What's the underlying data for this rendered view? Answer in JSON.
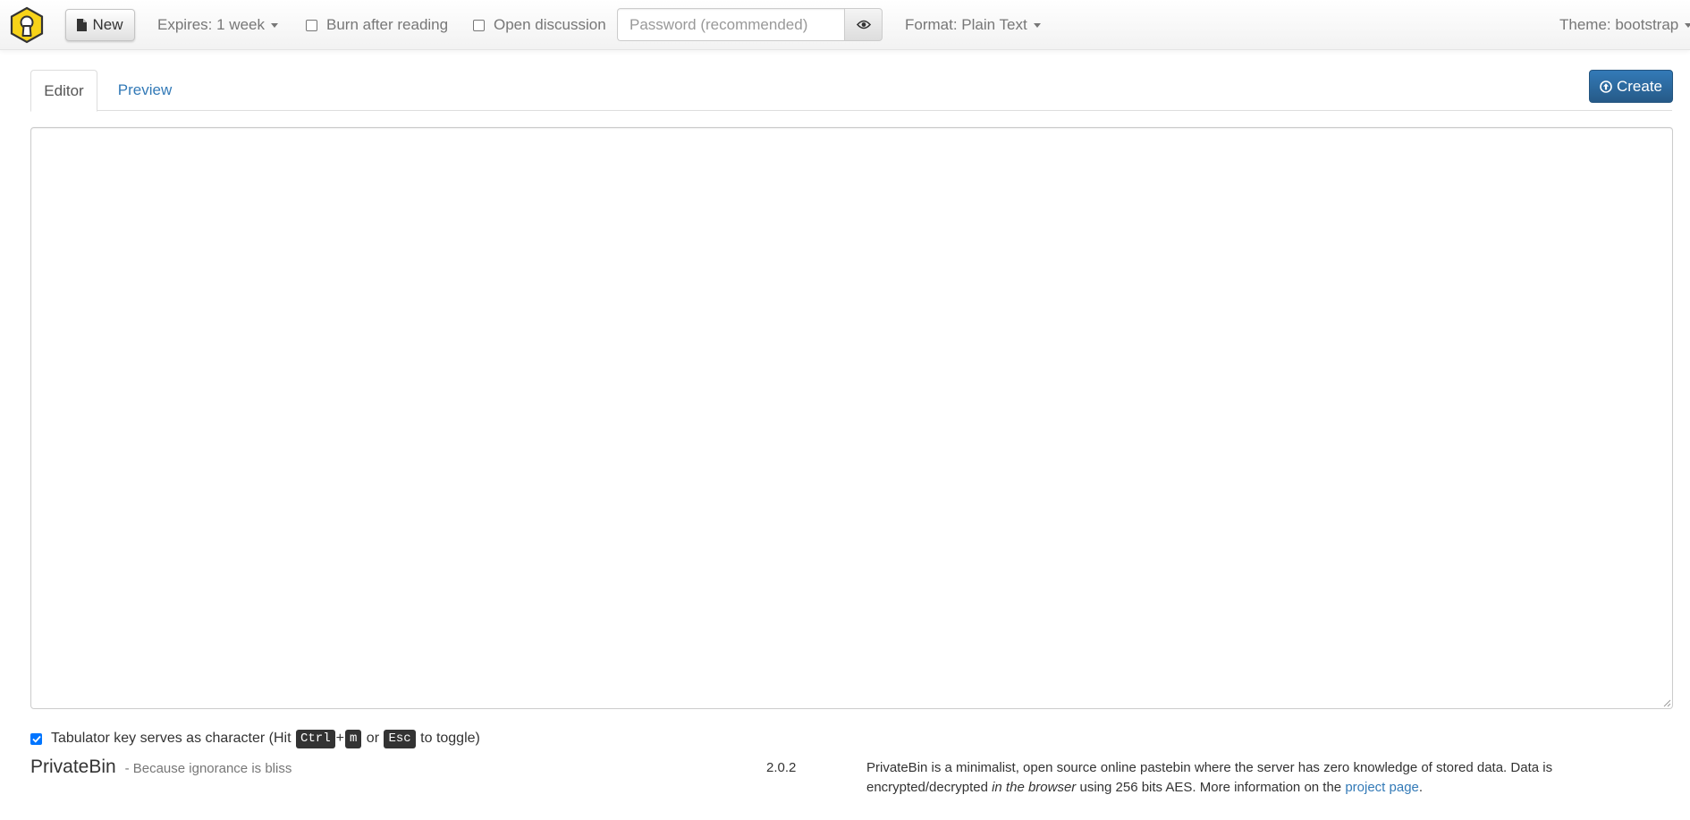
{
  "navbar": {
    "new_label": "New",
    "expires_label": "Expires: 1 week",
    "burn_label": "Burn after reading",
    "burn_checked": false,
    "discussion_label": "Open discussion",
    "discussion_checked": false,
    "password_placeholder": "Password (recommended)",
    "password_value": "",
    "format_label": "Format: Plain Text",
    "theme_label": "Theme: bootstrap"
  },
  "tabs": {
    "editor_label": "Editor",
    "preview_label": "Preview",
    "active": "Editor"
  },
  "create_label": "Create",
  "editor": {
    "value": ""
  },
  "tab_option": {
    "checked": true,
    "text_before": "Tabulator key serves as character (Hit ",
    "key_ctrl": "Ctrl",
    "plus": "+",
    "key_m": "m",
    "or_text": " or ",
    "key_esc": "Esc",
    "text_after": " to toggle)"
  },
  "footer": {
    "app_name": "PrivateBin",
    "tagline": "- Because ignorance is bliss",
    "version": "2.0.2",
    "about_part1": "PrivateBin is a minimalist, open source online pastebin where the server has zero knowledge of stored data. Data is encrypted/decrypted ",
    "about_italic": "in the browser",
    "about_part2": " using 256 bits AES. More information on the ",
    "about_link": "project page",
    "about_end": "."
  },
  "colors": {
    "link": "#337ab7",
    "primary": "#337ab7",
    "logo_fill": "#f7d319",
    "text_muted": "#777777"
  }
}
